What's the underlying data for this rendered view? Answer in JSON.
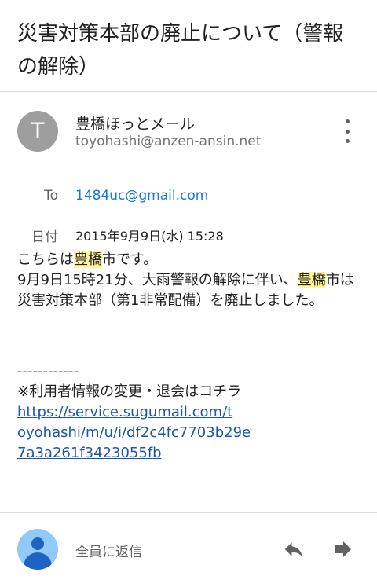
{
  "email": {
    "subject": "災害対策本部の廃止について（警報の解除）",
    "sender": {
      "avatar_letter": "T",
      "name": "豊橋ほっとメール",
      "email": "toyohashi@anzen-ansin.net"
    },
    "to_label": "To",
    "to_value": "1484uc@gmail.com",
    "date_label": "日付",
    "date_value": "2015年9月9日(水) 15:28",
    "body": {
      "l1_pre": "こちらは",
      "l1_hl": "豊橋",
      "l1_post": "市です。",
      "l2_pre": "9月9日15時21分、大雨警報の解除に伴い、",
      "l2_hl": "豊橋",
      "l3": "市は災害対策本部（第1非常配備）を廃止しました。",
      "separator": "------------",
      "footer": "※利用者情報の変更・退会はコチラ",
      "link_1": "https://service.sugumail.com/t",
      "link_2": "oyohashi/m/u/i/df2c4fc7703b29e",
      "link_3": "7a3a261f3423055fb"
    }
  },
  "reply_bar": {
    "reply_all_label": "全員に返信",
    "reply_icon": "reply-icon",
    "forward_icon": "forward-icon"
  },
  "colors": {
    "highlight": "#fff59d",
    "link": "#1a56b0",
    "to_value": "#1976d2",
    "avatar_sender": "#9e9e9e",
    "avatar_user": "#90caf9"
  }
}
